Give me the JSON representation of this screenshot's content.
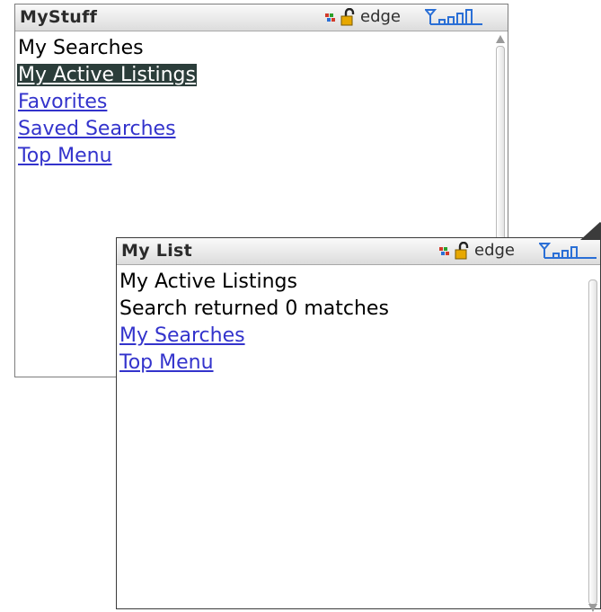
{
  "screens": [
    {
      "title": "MyStuff",
      "network": "edge",
      "items": [
        {
          "label": "My Searches"
        },
        {
          "label": "My Active Listings"
        },
        {
          "label": "Favorites"
        },
        {
          "label": "Saved Searches"
        },
        {
          "label": "Top Menu"
        }
      ]
    },
    {
      "title": "My List",
      "network": "edge",
      "items": [
        {
          "label": "My Active Listings"
        },
        {
          "label": "Search returned 0 matches"
        },
        {
          "label": "My Searches"
        },
        {
          "label": "Top Menu"
        }
      ]
    }
  ],
  "icons": {
    "data_transfer": "data-transfer-icon",
    "lock": "lock-icon",
    "signal": "signal-strength-icon",
    "scroll_up": "scroll-up-arrow-icon",
    "scroll_down": "scroll-down-arrow-icon",
    "window_arrow": "up-arrow-icon"
  },
  "colors": {
    "link": "#3333cc",
    "selection": "#2b3d3a",
    "lock": "#e7a800",
    "signal": "#2a6fd6"
  }
}
